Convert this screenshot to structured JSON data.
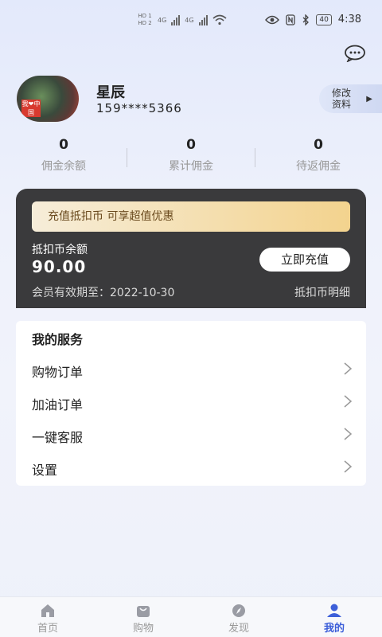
{
  "status_bar": {
    "sim1": "HD 1",
    "sim2": "HD 2",
    "net1": "4G",
    "net2": "4G",
    "battery": "40",
    "time": "4:38"
  },
  "header": {
    "chat_icon": "chat-bubble-icon"
  },
  "profile": {
    "name": "星辰",
    "phone": "159****5366",
    "edit_label_line1": "修改",
    "edit_label_line2": "资料",
    "edit_arrow": "▶",
    "avatar_text": "我❤中国"
  },
  "stats": [
    {
      "value": "0",
      "label": "佣金余额"
    },
    {
      "value": "0",
      "label": "累计佣金"
    },
    {
      "value": "0",
      "label": "待返佣金"
    }
  ],
  "coin_card": {
    "banner": "充值抵扣币 可享超值优惠",
    "balance_label": "抵扣币余额",
    "balance": "90.00",
    "recharge_button": "立即充值",
    "expire": "会员有效期至：2022-10-30",
    "detail_link": "抵扣币明细",
    "bg_color": "#3a3a3c",
    "banner_gradient": [
      "#f6edd9",
      "#f3d38e"
    ]
  },
  "services": {
    "title": "我的服务",
    "items": [
      {
        "label": "购物订单"
      },
      {
        "label": "加油订单"
      },
      {
        "label": "一键客服"
      },
      {
        "label": "设置"
      }
    ]
  },
  "tabbar": {
    "active_color": "#3d5fd9",
    "items": [
      {
        "label": "首页",
        "icon": "home-icon"
      },
      {
        "label": "购物",
        "icon": "shopping-bag-icon"
      },
      {
        "label": "发现",
        "icon": "compass-icon"
      },
      {
        "label": "我的",
        "icon": "user-icon"
      }
    ]
  }
}
